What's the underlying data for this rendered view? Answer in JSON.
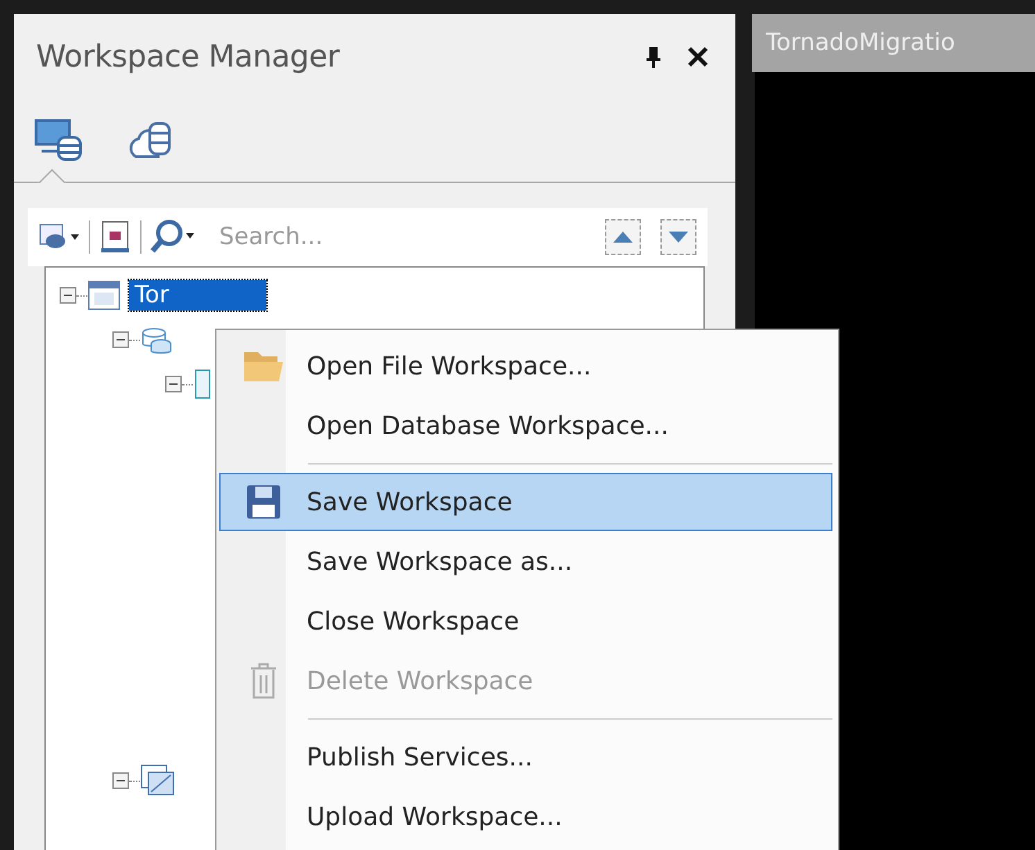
{
  "panel": {
    "title": "Workspace Manager",
    "view_tabs": [
      {
        "kind": "local",
        "selected": true
      },
      {
        "kind": "cloud",
        "selected": false
      }
    ],
    "search": {
      "placeholder": "Search..."
    }
  },
  "tree": [
    {
      "label": "Tor",
      "kind": "workspace",
      "expanded": true,
      "selected": true,
      "children": [
        {
          "kind": "datasources",
          "expanded": true,
          "children": [
            {
              "kind": "datasource",
              "expanded": true
            }
          ]
        },
        {
          "kind": "maps",
          "expanded": true
        }
      ]
    }
  ],
  "editor_tab": {
    "title": "TornadoMigratio"
  },
  "context_menu": [
    {
      "kind": "item",
      "label": "Open File Workspace...",
      "selected": false,
      "disabled": false
    },
    {
      "kind": "item",
      "label": "Open Database Workspace...",
      "selected": false,
      "disabled": false
    },
    {
      "kind": "separator"
    },
    {
      "kind": "item",
      "label": "Save Workspace",
      "selected": true,
      "disabled": false
    },
    {
      "kind": "item",
      "label": "Save Workspace as...",
      "selected": false,
      "disabled": false
    },
    {
      "kind": "item",
      "label": "Close Workspace",
      "selected": false,
      "disabled": false
    },
    {
      "kind": "item",
      "label": "Delete Workspace",
      "selected": false,
      "disabled": true
    },
    {
      "kind": "separator"
    },
    {
      "kind": "item",
      "label": "Publish Services...",
      "selected": false,
      "disabled": false
    },
    {
      "kind": "item",
      "label": "Upload Workspace...",
      "selected": false,
      "disabled": false
    }
  ]
}
